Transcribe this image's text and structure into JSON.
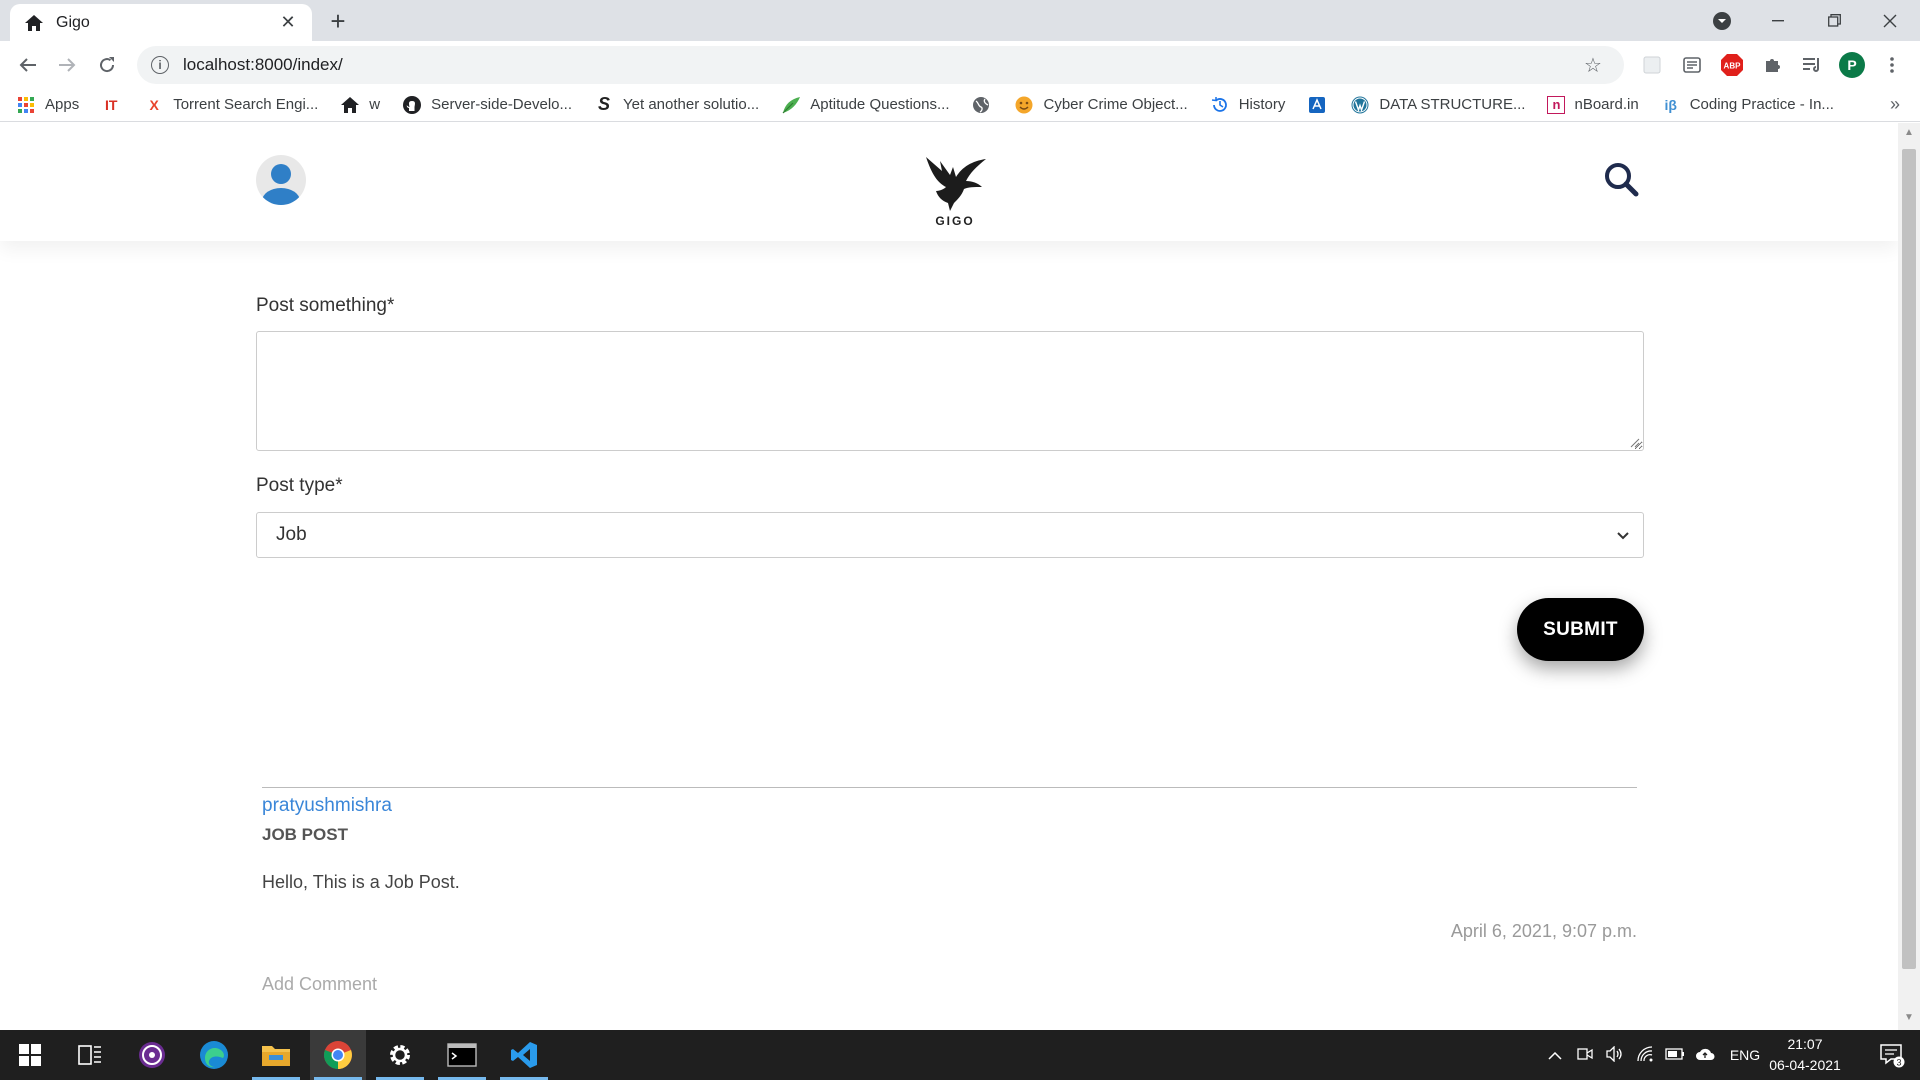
{
  "browser": {
    "tab_title": "Gigo",
    "url": "localhost:8000/index/",
    "profile_initial": "P",
    "ext_abp_label": "ABP",
    "bookmarks": [
      {
        "label": "Apps",
        "icon": "apps-grid-icon"
      },
      {
        "label": "",
        "icon": "it-icon",
        "glyph": "IT",
        "color": "#d93025"
      },
      {
        "label": "Torrent Search Engi...",
        "icon": "torrent-x-icon",
        "glyph": "X",
        "color": "#e8442c"
      },
      {
        "label": "w",
        "icon": "home-icon"
      },
      {
        "label": "Server-side-Develo...",
        "icon": "github-icon"
      },
      {
        "label": "Yet another solutio...",
        "icon": "s-logo-icon",
        "glyph": "S",
        "color": "#222"
      },
      {
        "label": "Aptitude Questions...",
        "icon": "leaf-icon"
      },
      {
        "label": "",
        "icon": "globe-icon"
      },
      {
        "label": "Cyber Crime Object...",
        "icon": "emoji-icon"
      },
      {
        "label": "History",
        "icon": "history-icon"
      },
      {
        "label": "",
        "icon": "app-square-icon"
      },
      {
        "label": "DATA STRUCTURE...",
        "icon": "wordpress-icon"
      },
      {
        "label": "nBoard.in",
        "icon": "nboard-icon",
        "glyph": "n",
        "color": "#c2185b"
      },
      {
        "label": "Coding Practice - In...",
        "icon": "ib-icon",
        "glyph": "iβ",
        "color": "#3f8fd2"
      }
    ]
  },
  "site": {
    "logo_text": "GIGO"
  },
  "form": {
    "post_label": "Post something*",
    "post_value": "",
    "type_label": "Post type*",
    "type_selected": "Job",
    "submit_label": "SUBMIT"
  },
  "post": {
    "username": "pratyushmishra",
    "type": "JOB POST",
    "body": "Hello, This is a Job Post.",
    "timestamp": "April 6, 2021, 9:07 p.m.",
    "add_comment": "Add Comment"
  },
  "taskbar": {
    "language": "ENG",
    "time": "21:07",
    "date": "06-04-2021",
    "notifications": "3"
  }
}
